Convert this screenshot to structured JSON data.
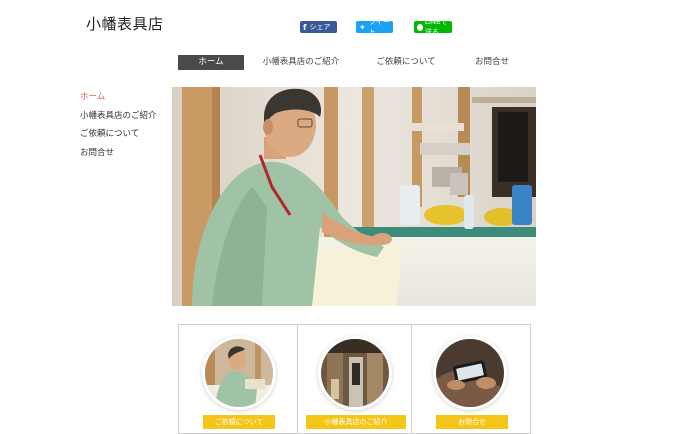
{
  "header": {
    "site_title": "小幡表具店"
  },
  "social": {
    "facebook_label": "シェア",
    "twitter_label": "ツイート",
    "line_label": "LINEで送る"
  },
  "topnav": {
    "items": [
      {
        "label": "ホーム"
      },
      {
        "label": "小幡表具店のご紹介"
      },
      {
        "label": "ご依頼について"
      },
      {
        "label": "お問合せ"
      }
    ]
  },
  "sidenav": {
    "items": [
      {
        "label": "ホーム"
      },
      {
        "label": "小幡表具店のご紹介"
      },
      {
        "label": "ご依頼について"
      },
      {
        "label": "お問合せ"
      }
    ]
  },
  "cards": [
    {
      "label": "ご依頼について"
    },
    {
      "label": "小幡表具店のご紹介"
    },
    {
      "label": "お問合せ"
    }
  ],
  "colors": {
    "active_nav_bg": "#4a4a4a",
    "side_active": "#e0594f",
    "card_label": "#f5c518"
  }
}
